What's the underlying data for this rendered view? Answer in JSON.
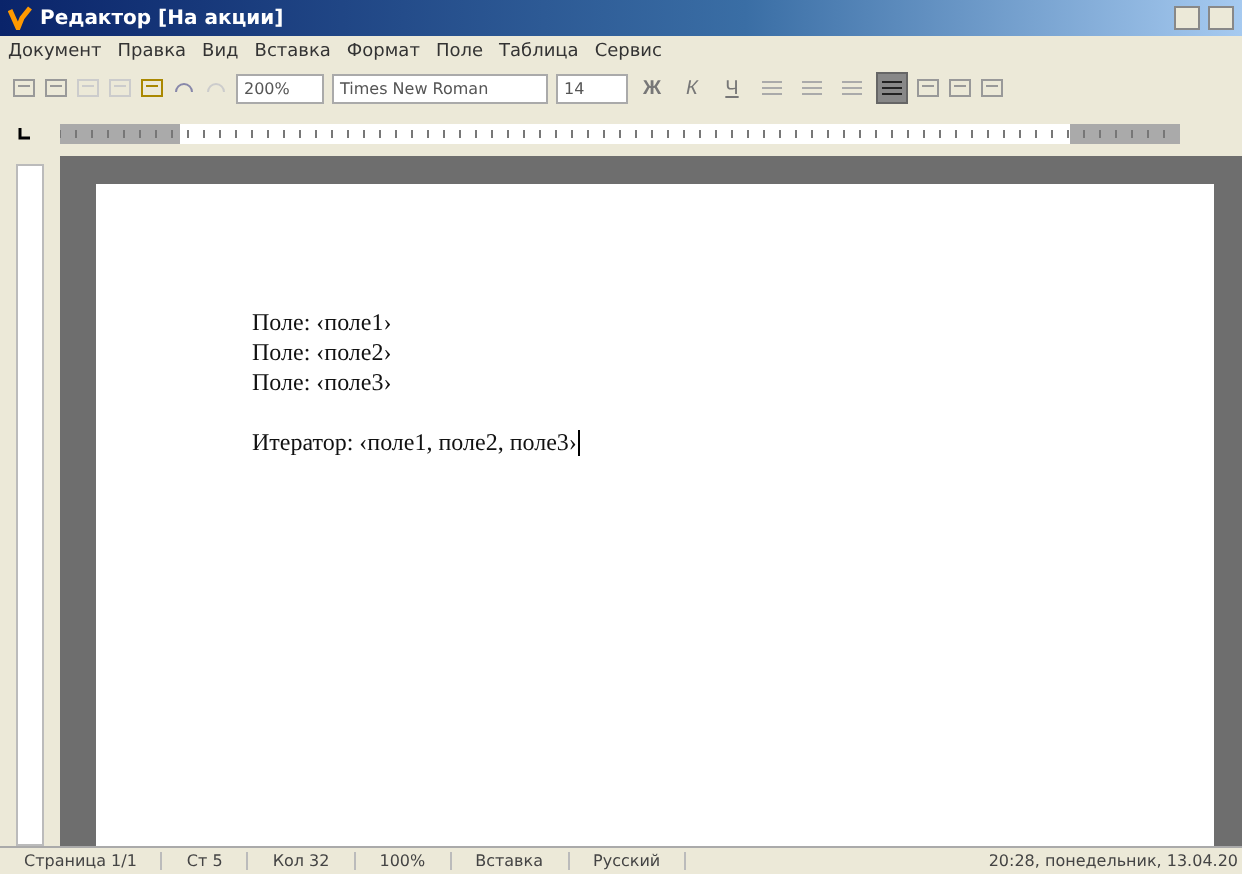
{
  "window": {
    "title": "Редактор [На акции]"
  },
  "menu": [
    "Документ",
    "Правка",
    "Вид",
    "Вставка",
    "Формат",
    "Поле",
    "Таблица",
    "Сервис"
  ],
  "toolbar": {
    "zoom": "200%",
    "font": "Times New Roman",
    "size": "14",
    "format_buttons": [
      {
        "label": "Ж",
        "kind": "bold"
      },
      {
        "label": "К",
        "kind": "italic"
      },
      {
        "label": "Ч",
        "kind": "underline"
      }
    ],
    "align": [
      {
        "selected": false
      },
      {
        "selected": false
      },
      {
        "selected": false
      },
      {
        "selected": true
      }
    ]
  },
  "document": {
    "lines": [
      {
        "text": "Поле: ‹поле1›",
        "kind": "line"
      },
      {
        "text": "Поле: ‹поле2›",
        "kind": "line"
      },
      {
        "text": "Поле: ‹поле3›",
        "kind": "line"
      },
      {
        "text": "Итератор: ‹поле1, поле2, поле3›",
        "kind": "cursor"
      }
    ]
  },
  "status_bar": [
    "Страница 1/1",
    "Ст 5",
    "Кол 32",
    "100%",
    "Вставка",
    "Русский"
  ],
  "clock": "20:28, понедельник, 13.04.20"
}
